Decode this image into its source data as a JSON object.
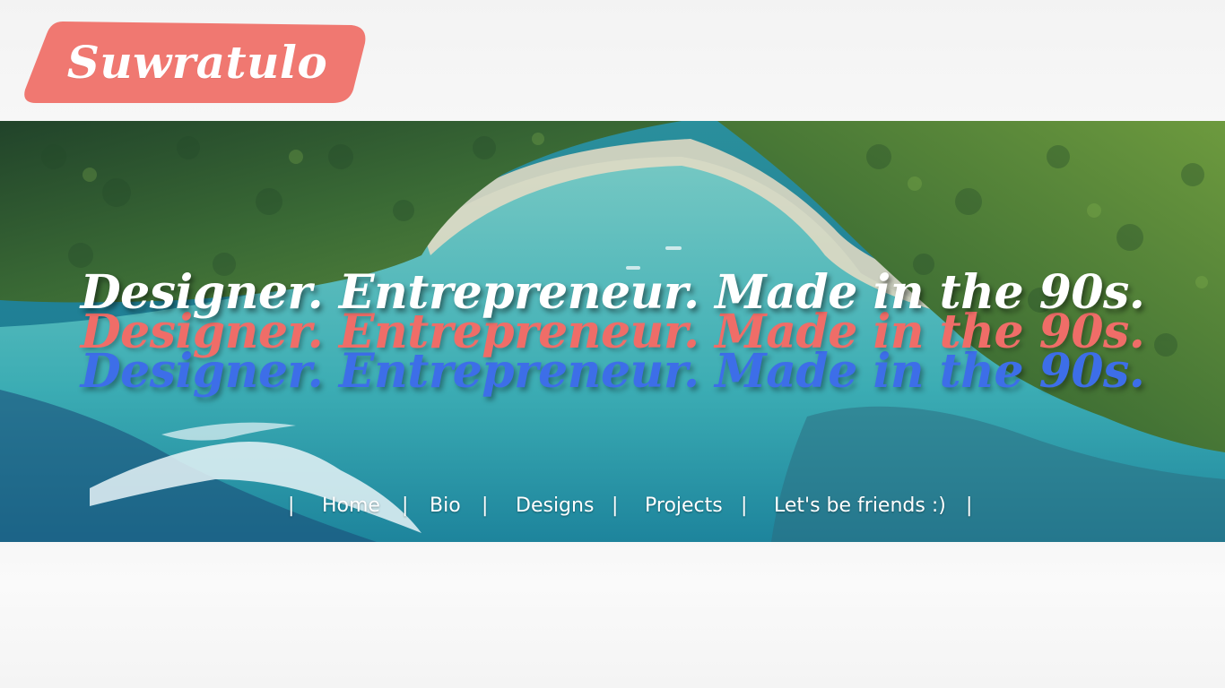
{
  "header": {
    "logo_text": "Suwratulo",
    "logo_color": "#f07871"
  },
  "hero": {
    "headline": "Designer. Entrepreneur. Made in the 90s.",
    "headline_colors": {
      "front": "#ffffff",
      "middle": "#ef6d68",
      "back": "#3d6ee8"
    }
  },
  "nav": {
    "separator": "|",
    "items": [
      {
        "label": "Home"
      },
      {
        "label": "Bio"
      },
      {
        "label": "Designs"
      },
      {
        "label": "Projects"
      },
      {
        "label": "Let's be friends :)"
      }
    ]
  }
}
